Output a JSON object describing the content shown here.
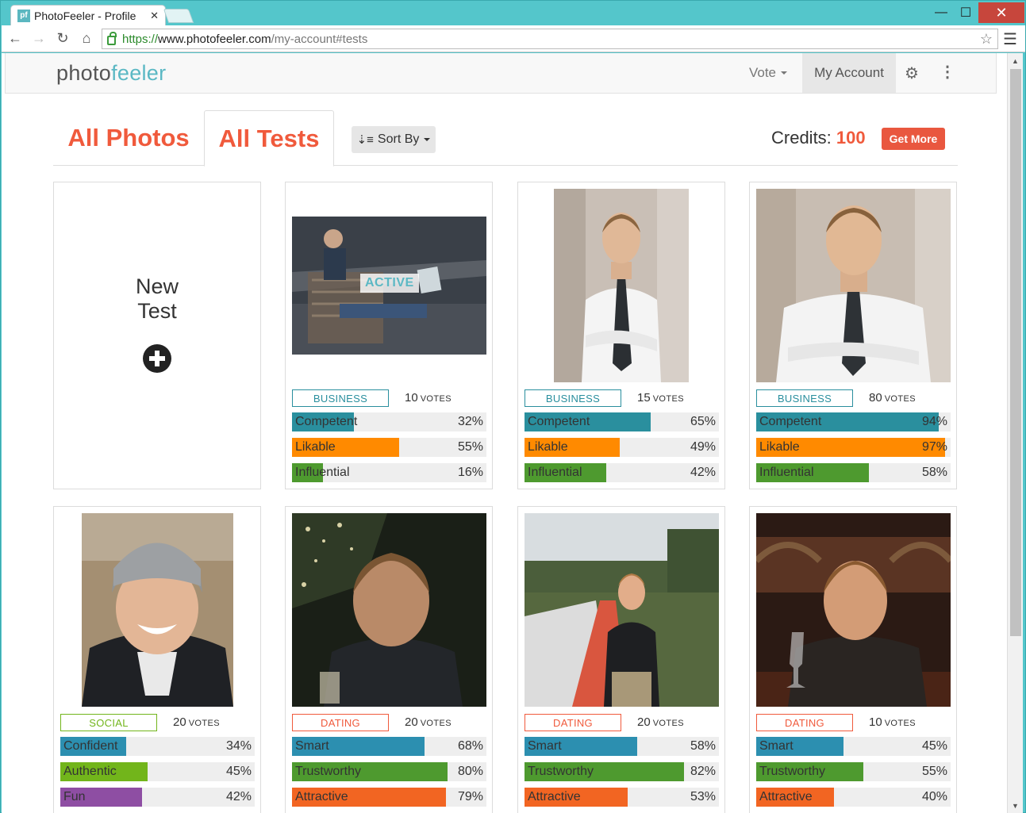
{
  "browser": {
    "tab_title": "PhotoFeeler - Profile",
    "favicon_text": "pf",
    "url_scheme": "https://",
    "url_host": "www.photofeeler.com",
    "url_path": "/my-account#tests"
  },
  "navbar": {
    "logo_part1": "photo",
    "logo_part2": "feeler",
    "vote_label": "Vote",
    "account_label": "My Account"
  },
  "page_tabs": {
    "all_photos": "All Photos",
    "all_tests": "All Tests",
    "sort_by": "Sort By"
  },
  "credits": {
    "label": "Credits:",
    "value": "100",
    "get_more": "Get More"
  },
  "new_test": {
    "line1": "New",
    "line2": "Test"
  },
  "votes_suffix": "VOTES",
  "colors": {
    "accent": "#f05a3c",
    "teal": "#2a8f9e",
    "orange": "#ff8a00",
    "green": "#4e9a2f",
    "blue": "#2c8fb0",
    "lime": "#72b51b",
    "purple": "#8e4ea3",
    "red_orange": "#f26522"
  },
  "tests": [
    {
      "category": "BUSINESS",
      "votes": "10",
      "active_badge": "ACTIVE",
      "stats": [
        {
          "label": "Competent",
          "pct": "32%",
          "value": 32,
          "color": "teal"
        },
        {
          "label": "Likable",
          "pct": "55%",
          "value": 55,
          "color": "orange"
        },
        {
          "label": "Influential",
          "pct": "16%",
          "value": 16,
          "color": "green"
        }
      ]
    },
    {
      "category": "BUSINESS",
      "votes": "15",
      "stats": [
        {
          "label": "Competent",
          "pct": "65%",
          "value": 65,
          "color": "teal"
        },
        {
          "label": "Likable",
          "pct": "49%",
          "value": 49,
          "color": "orange"
        },
        {
          "label": "Influential",
          "pct": "42%",
          "value": 42,
          "color": "green"
        }
      ]
    },
    {
      "category": "BUSINESS",
      "votes": "80",
      "stats": [
        {
          "label": "Competent",
          "pct": "94%",
          "value": 94,
          "color": "teal"
        },
        {
          "label": "Likable",
          "pct": "97%",
          "value": 97,
          "color": "orange"
        },
        {
          "label": "Influential",
          "pct": "58%",
          "value": 58,
          "color": "green"
        }
      ]
    },
    {
      "category": "SOCIAL",
      "votes": "20",
      "stats": [
        {
          "label": "Confident",
          "pct": "34%",
          "value": 34,
          "color": "blue"
        },
        {
          "label": "Authentic",
          "pct": "45%",
          "value": 45,
          "color": "lime"
        },
        {
          "label": "Fun",
          "pct": "42%",
          "value": 42,
          "color": "purple"
        }
      ]
    },
    {
      "category": "DATING",
      "votes": "20",
      "stats": [
        {
          "label": "Smart",
          "pct": "68%",
          "value": 68,
          "color": "blue"
        },
        {
          "label": "Trustworthy",
          "pct": "80%",
          "value": 80,
          "color": "green"
        },
        {
          "label": "Attractive",
          "pct": "79%",
          "value": 79,
          "color": "red_orange"
        }
      ]
    },
    {
      "category": "DATING",
      "votes": "20",
      "stats": [
        {
          "label": "Smart",
          "pct": "58%",
          "value": 58,
          "color": "blue"
        },
        {
          "label": "Trustworthy",
          "pct": "82%",
          "value": 82,
          "color": "green"
        },
        {
          "label": "Attractive",
          "pct": "53%",
          "value": 53,
          "color": "red_orange"
        }
      ]
    },
    {
      "category": "DATING",
      "votes": "10",
      "stats": [
        {
          "label": "Smart",
          "pct": "45%",
          "value": 45,
          "color": "blue"
        },
        {
          "label": "Trustworthy",
          "pct": "55%",
          "value": 55,
          "color": "green"
        },
        {
          "label": "Attractive",
          "pct": "40%",
          "value": 40,
          "color": "red_orange"
        }
      ]
    }
  ]
}
